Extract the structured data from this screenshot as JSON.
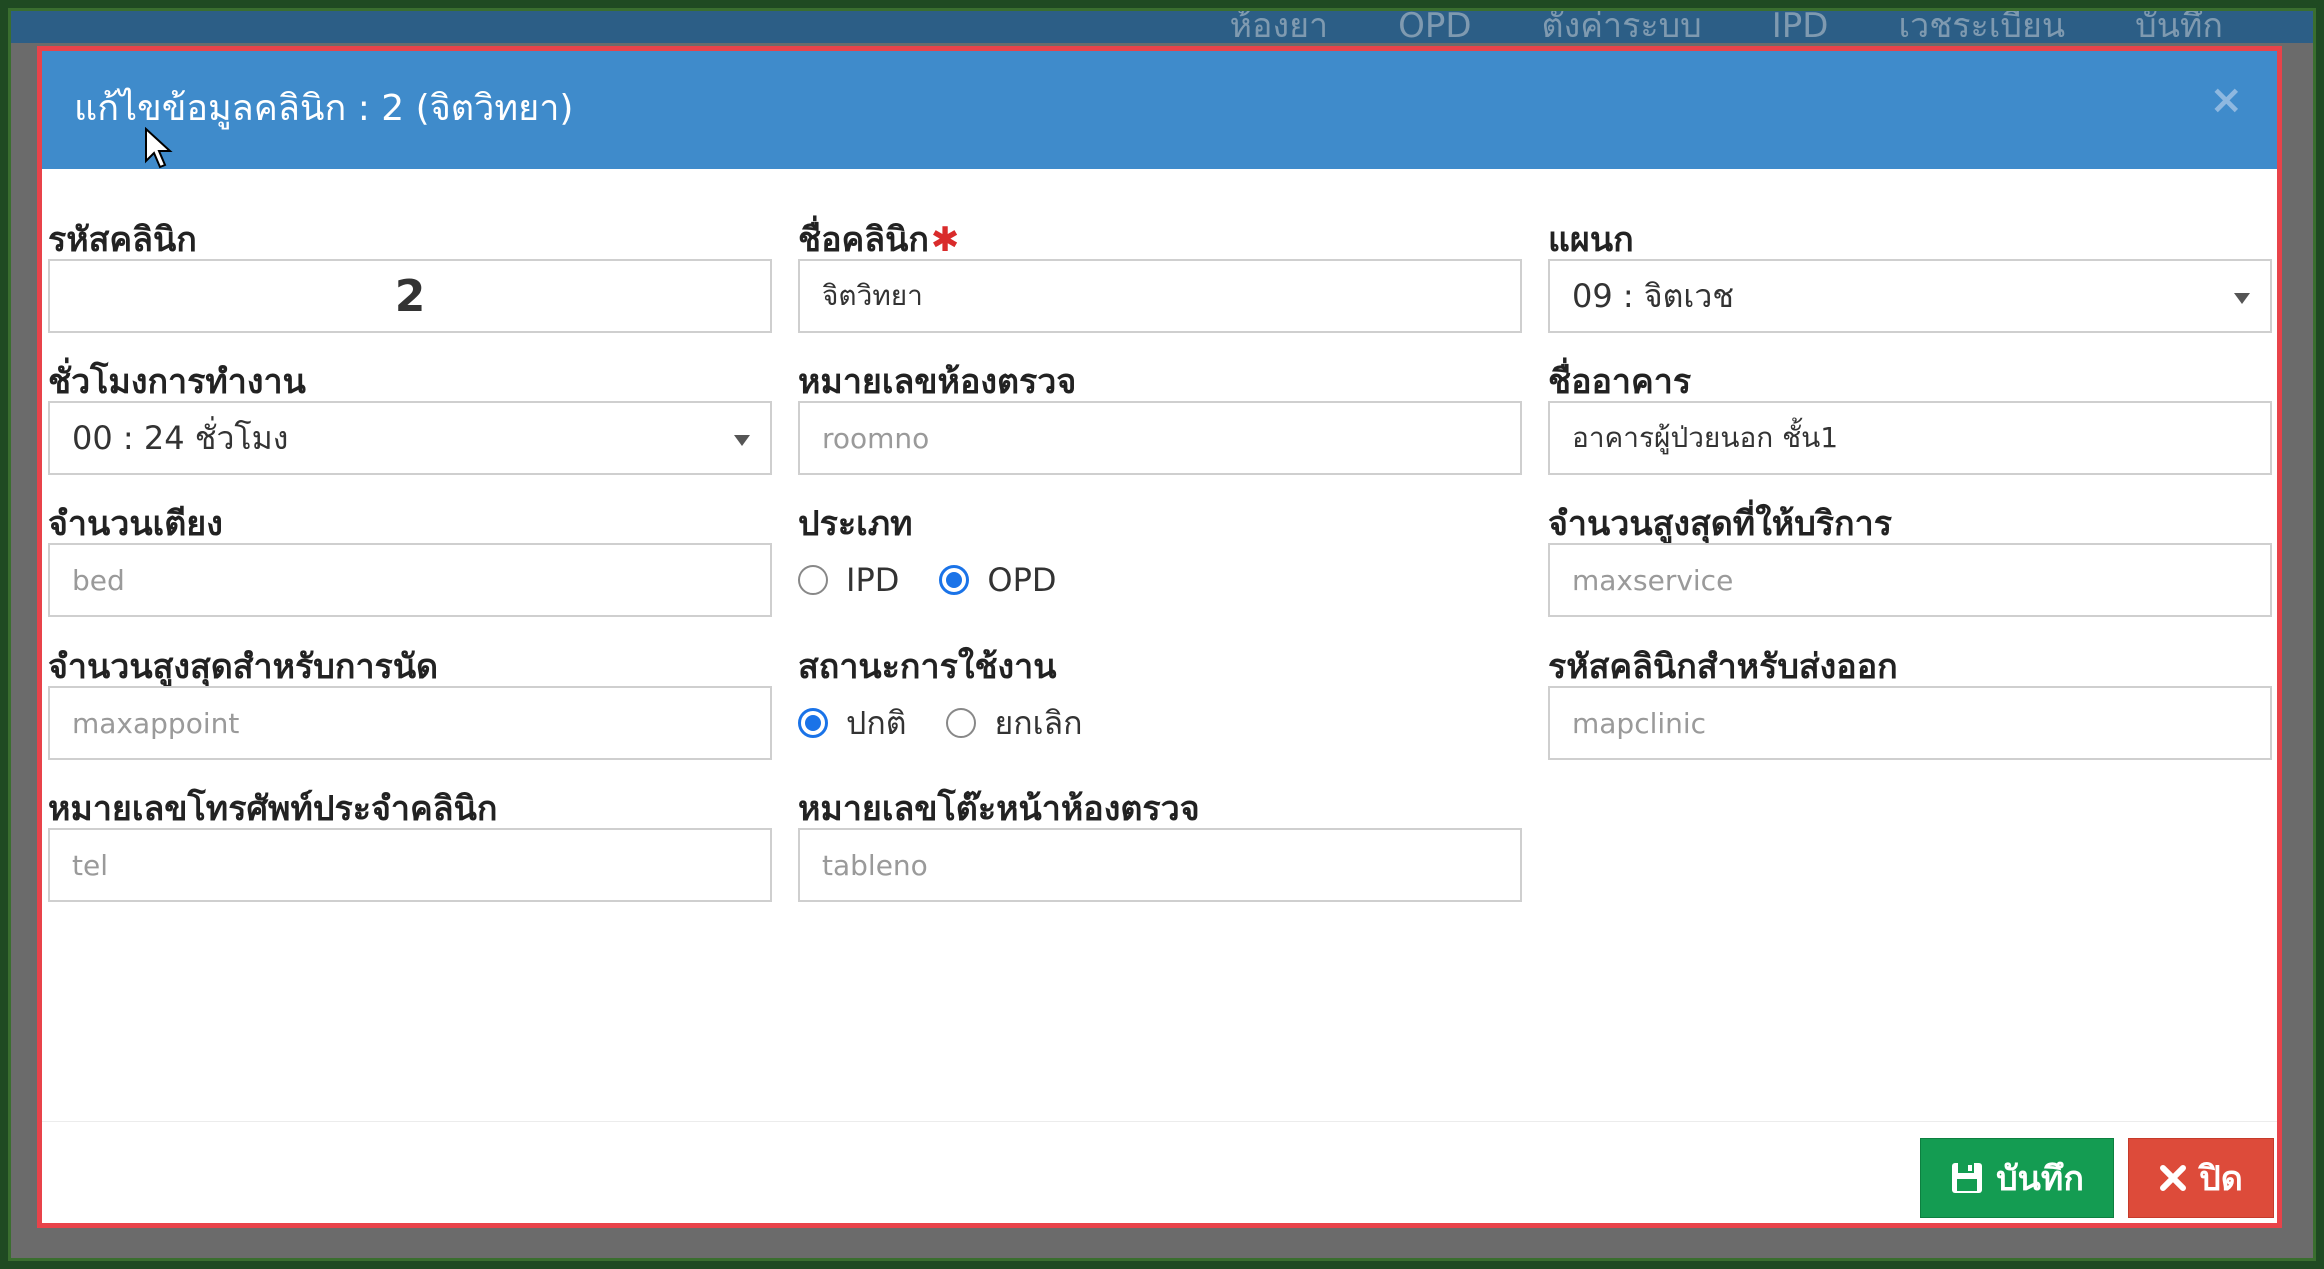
{
  "background": {
    "nav_items": [
      "ห้องยา",
      "OPD",
      "ตั้งค่าระบบ",
      "IPD",
      "เวชระเบียน",
      "บันทึก"
    ]
  },
  "modal": {
    "title": "แก้ไขข้อมูลคลินิก : 2 (จิตวิทยา)",
    "close_symbol": "×"
  },
  "form": {
    "clinic_code": {
      "label": "รหัสคลินิก",
      "value": "2"
    },
    "clinic_name": {
      "label": "ชื่อคลินิก",
      "required_mark": "✱",
      "value": "จิตวิทยา"
    },
    "department": {
      "label": "แผนก",
      "value": "09 : จิตเวช"
    },
    "work_hours": {
      "label": "ชั่วโมงการทำงาน",
      "value": "00 : 24 ชั่วโมง"
    },
    "room_no": {
      "label": "หมายเลขห้องตรวจ",
      "placeholder": "roomno"
    },
    "building": {
      "label": "ชื่ออาคาร",
      "value": "อาคารผู้ป่วยนอก ชั้น1"
    },
    "beds": {
      "label": "จำนวนเตียง",
      "placeholder": "bed"
    },
    "type": {
      "label": "ประเภท",
      "options": [
        "IPD",
        "OPD"
      ],
      "selected": "OPD"
    },
    "max_service": {
      "label": "จำนวนสูงสุดที่ให้บริการ",
      "placeholder": "maxservice"
    },
    "max_appoint": {
      "label": "จำนวนสูงสุดสำหรับการนัด",
      "placeholder": "maxappoint"
    },
    "status": {
      "label": "สถานะการใช้งาน",
      "options": [
        "ปกติ",
        "ยกเลิก"
      ],
      "selected": "ปกติ"
    },
    "export_code": {
      "label": "รหัสคลินิกสำหรับส่งออก",
      "placeholder": "mapclinic"
    },
    "phone": {
      "label": "หมายเลขโทรศัพท์ประจำคลินิก",
      "placeholder": "tel"
    },
    "table_no": {
      "label": "หมายเลขโต๊ะหน้าห้องตรวจ",
      "placeholder": "tableno"
    }
  },
  "buttons": {
    "save": "บันทึก",
    "close": "ปิด"
  },
  "colors": {
    "header": "#3f8bcb",
    "save": "#149c52",
    "close": "#dd4b3a",
    "modal_border": "#e8434a",
    "required": "#d92b2b",
    "radio_accent": "#1a73e8"
  }
}
